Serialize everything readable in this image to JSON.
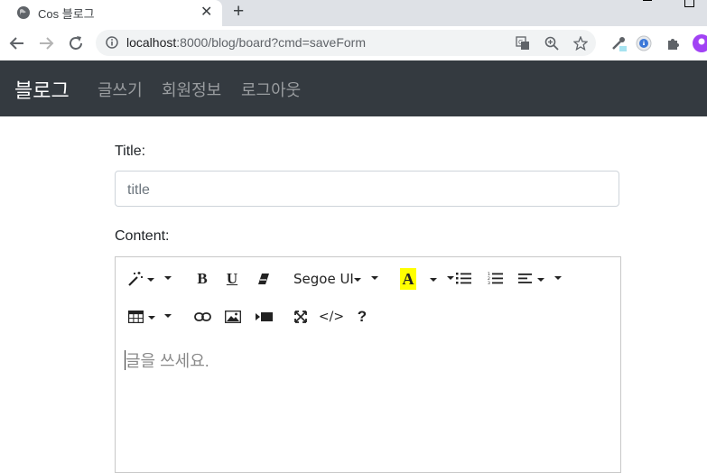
{
  "browser": {
    "tab_title": "Cos 블로그",
    "new_tab_label": "+",
    "url_host": "localhost",
    "url_path": ":8000/blog/board?cmd=saveForm"
  },
  "navbar": {
    "brand": "블로그",
    "links": [
      "글쓰기",
      "회원정보",
      "로그아웃"
    ]
  },
  "form": {
    "title_label": "Title:",
    "title_placeholder": "title",
    "content_label": "Content:",
    "content_placeholder": "글을 쓰세요."
  },
  "editor_toolbar": {
    "bold": "B",
    "underline": "U",
    "font_name": "Segoe UI",
    "forecolor": "A",
    "code_view": "</>",
    "help": "?",
    "icons": [
      "magic-icon",
      "eraser-icon",
      "unordered-list-icon",
      "ordered-list-icon",
      "align-icon",
      "table-icon",
      "link-icon",
      "picture-icon",
      "video-icon",
      "fullscreen-icon"
    ]
  },
  "colors": {
    "navbar_bg": "#343a40",
    "highlight": "#ffff00"
  }
}
